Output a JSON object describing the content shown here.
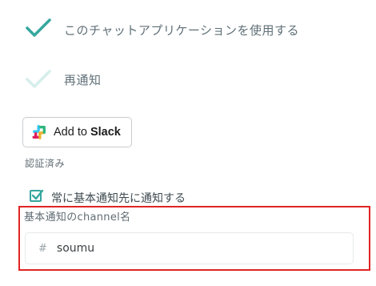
{
  "settings": {
    "use_app_label": "このチャットアプリケーションを使用する",
    "renotify_label": "再通知"
  },
  "slack": {
    "button_prefix": "Add to ",
    "button_bold": "Slack",
    "status": "認証済み"
  },
  "notify": {
    "always_label": "常に基本通知先に通知する",
    "always_checked": true,
    "channel_label": "基本通知のchannel名",
    "channel_prefix": "#",
    "channel_value": "soumu"
  },
  "colors": {
    "accent": "#35a79e",
    "accent_faint": "#d6eeeb",
    "highlight": "#e02424"
  }
}
